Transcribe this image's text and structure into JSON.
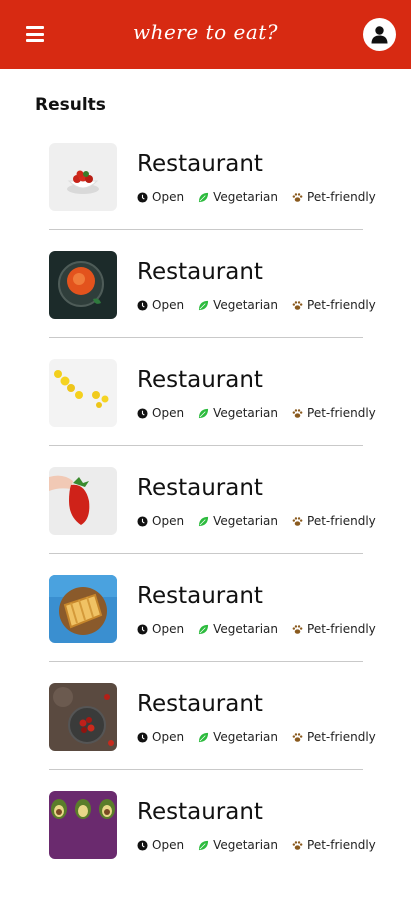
{
  "app": {
    "title": "where to eat?"
  },
  "colors": {
    "appbar": "#d72a12",
    "vegetarian": "#2dbb3e",
    "pet": "#8a5a1e"
  },
  "results": {
    "heading": "Results"
  },
  "restaurants": [
    {
      "name": "Restaurant",
      "status": "Open",
      "diet": "Vegetarian",
      "pets": "Pet-friendly",
      "image": "strawberry-bowl"
    },
    {
      "name": "Restaurant",
      "status": "Open",
      "diet": "Vegetarian",
      "pets": "Pet-friendly",
      "image": "tomato-soup"
    },
    {
      "name": "Restaurant",
      "status": "Open",
      "diet": "Vegetarian",
      "pets": "Pet-friendly",
      "image": "lemons"
    },
    {
      "name": "Restaurant",
      "status": "Open",
      "diet": "Vegetarian",
      "pets": "Pet-friendly",
      "image": "strawberry-hand"
    },
    {
      "name": "Restaurant",
      "status": "Open",
      "diet": "Vegetarian",
      "pets": "Pet-friendly",
      "image": "sandwich"
    },
    {
      "name": "Restaurant",
      "status": "Open",
      "diet": "Vegetarian",
      "pets": "Pet-friendly",
      "image": "berries-bowl"
    },
    {
      "name": "Restaurant",
      "status": "Open",
      "diet": "Vegetarian",
      "pets": "Pet-friendly",
      "image": "avocado"
    }
  ]
}
